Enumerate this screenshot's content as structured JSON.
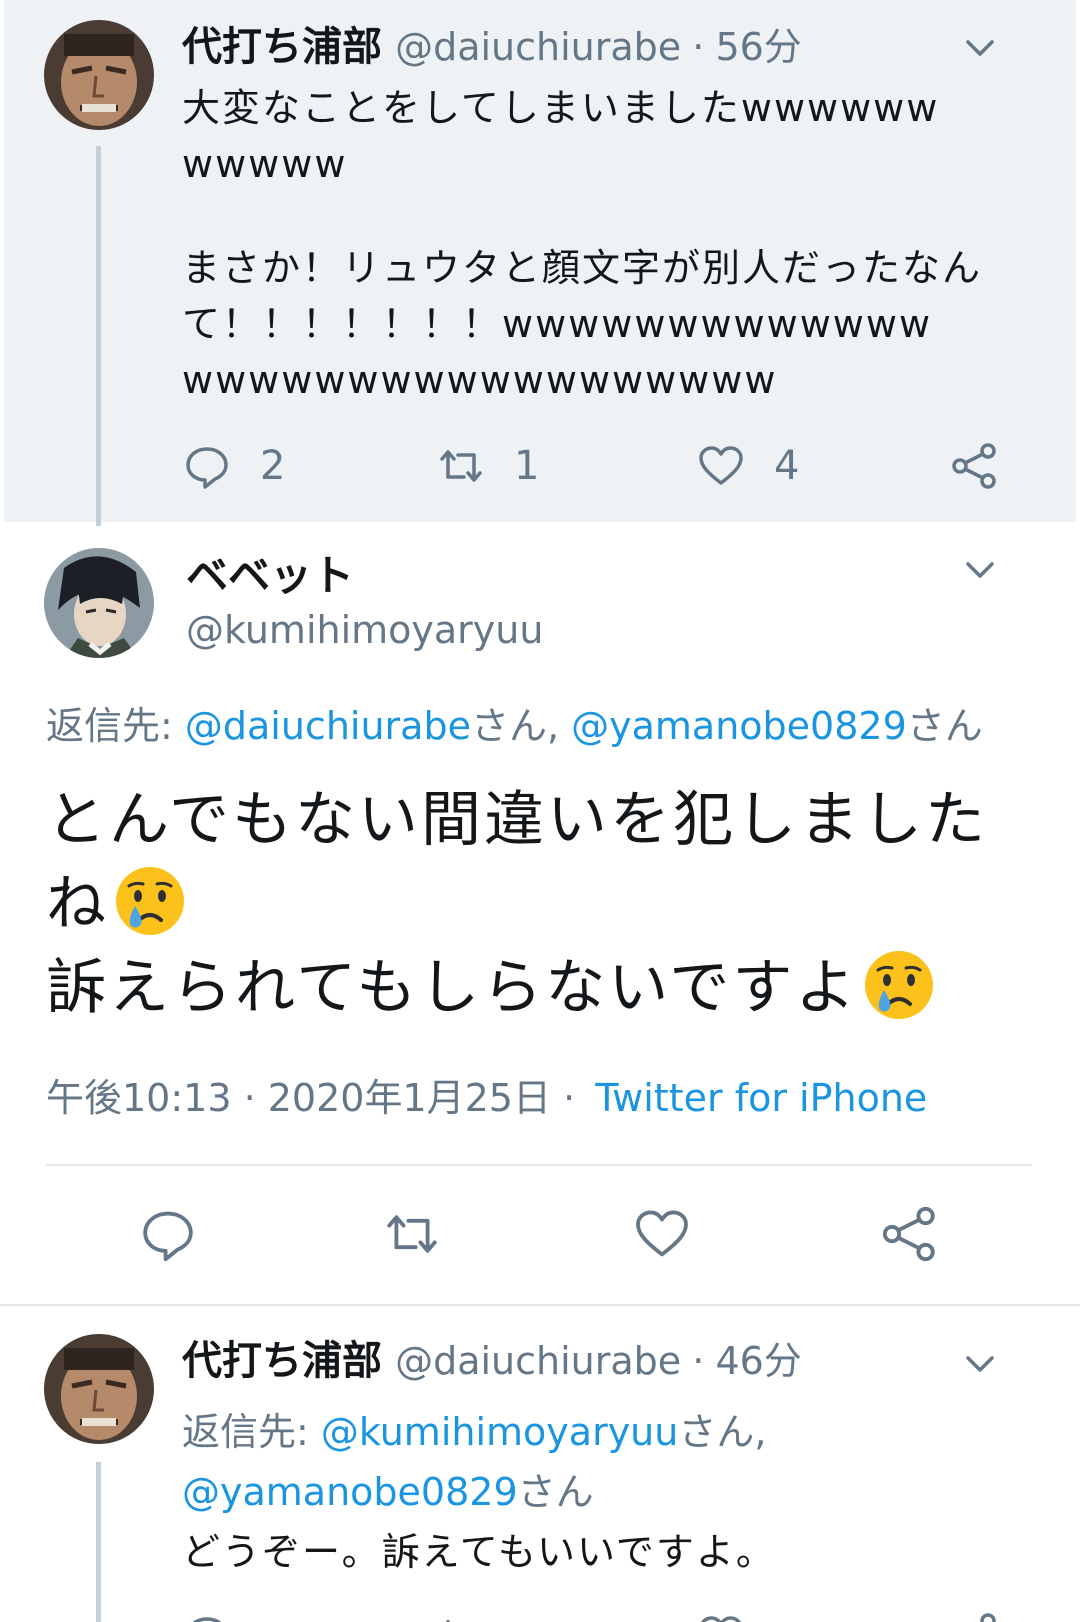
{
  "tweet1": {
    "name": "代打ち浦部",
    "handle": "@daiuchiurabe",
    "separator": "·",
    "time": "56分",
    "text_line1": "大変なことをしてしまいましたwwwwww",
    "text_line2": "wwwww",
    "text_line3": "まさか！リュウタと顔文字が別人だったなん",
    "text_line4": "て！！！！！！！wwwwwwwwwwwww",
    "text_line5": "wwwwwwwwwwwwwwwwww",
    "reply_count": "2",
    "retweet_count": "1",
    "like_count": "4"
  },
  "main_tweet": {
    "name": "ベベット",
    "handle": "@kumihimoyaryuu",
    "reply_label": "返信先: ",
    "reply_user1": "@daiuchiurabe",
    "reply_san1": "さん, ",
    "reply_user2": "@yamanobe0829",
    "reply_san2": "さん",
    "text_line1": "とんでもない間違いを犯しました",
    "text_line2": "ね",
    "text_line3": "訴えられてもしらないですよ",
    "emoji": "crying-face",
    "timestamp": "午後10:13 · 2020年1月25日 ·",
    "source": "Twitter for iPhone"
  },
  "tweet3": {
    "name": "代打ち浦部",
    "handle": "@daiuchiurabe",
    "separator": "·",
    "time": "46分",
    "reply_label": "返信先: ",
    "reply_user1": "@kumihimoyaryuu",
    "reply_san1": "さん,",
    "reply_user2": "@yamanobe0829",
    "reply_san2": "さん",
    "text": "どうぞー。訴えてもいいですよ。"
  },
  "colors": {
    "accent": "#1b95e0",
    "secondary_text": "#657786",
    "highlight_bg": "#eef2f5"
  }
}
